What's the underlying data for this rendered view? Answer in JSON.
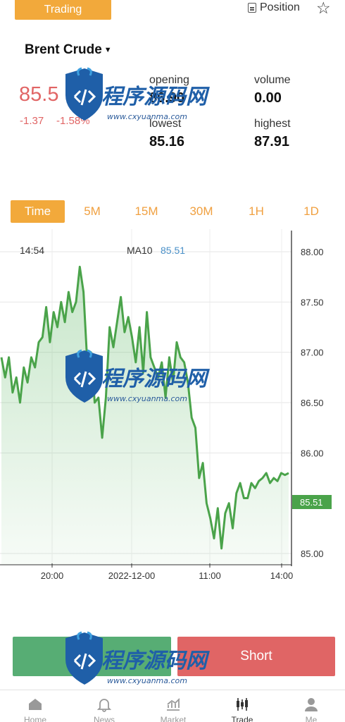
{
  "header": {
    "active_tab": "Trading",
    "position_label": "Position",
    "favorite_icon": "star-icon"
  },
  "instrument": {
    "name": "Brent Crude",
    "price": "85.5",
    "change": "-1.37",
    "change_percent": "-1.58%"
  },
  "stats": {
    "opening_label": "opening",
    "opening_value": "86.90",
    "volume_label": "volume",
    "volume_value": "0.00",
    "lowest_label": "lowest",
    "lowest_value": "85.16",
    "highest_label": "highest",
    "highest_value": "87.91"
  },
  "timeframes": [
    "Time",
    "5M",
    "15M",
    "30M",
    "1H",
    "1D"
  ],
  "timeframe_active": "Time",
  "chart": {
    "cursor_time": "14:54",
    "ma_label": "MA10",
    "ma_value": "85.51",
    "current_price_tag": "85.51"
  },
  "chart_data": {
    "type": "area",
    "title": "",
    "xlabel": "",
    "ylabel": "",
    "x_ticks": [
      "20:00",
      "2022-12-00",
      "11:00",
      "14:00"
    ],
    "y_ticks": [
      "88.00",
      "87.50",
      "87.00",
      "86.50",
      "86.00",
      "85.51",
      "85.00"
    ],
    "ylim": [
      84.9,
      88.1
    ],
    "grid": true,
    "series": [
      {
        "values": [
          86.95,
          86.75,
          86.95,
          86.6,
          86.75,
          86.5,
          86.85,
          86.7,
          86.95,
          86.85,
          87.1,
          87.15,
          87.45,
          87.1,
          87.4,
          87.25,
          87.5,
          87.3,
          87.6,
          87.4,
          87.5,
          87.85,
          87.6,
          86.9,
          87.0,
          86.5,
          86.55,
          86.15,
          86.55,
          87.25,
          87.05,
          87.3,
          87.55,
          87.2,
          87.35,
          87.15,
          86.9,
          87.25,
          86.8,
          87.4,
          86.95,
          86.85,
          86.75,
          86.9,
          86.55,
          86.95,
          86.7,
          87.1,
          86.95,
          86.9,
          86.7,
          86.35,
          86.25,
          85.75,
          85.9,
          85.5,
          85.35,
          85.15,
          85.45,
          85.05,
          85.4,
          85.5,
          85.25,
          85.6,
          85.7,
          85.55,
          85.55,
          85.7,
          85.65,
          85.72,
          85.75,
          85.8,
          85.7,
          85.75,
          85.72,
          85.8,
          85.78,
          85.8
        ]
      }
    ]
  },
  "actions": {
    "long_label": "",
    "short_label": "Short"
  },
  "nav": {
    "items": [
      {
        "label": "Home",
        "icon": "home-icon"
      },
      {
        "label": "News",
        "icon": "bell-icon"
      },
      {
        "label": "Market",
        "icon": "chart-icon"
      },
      {
        "label": "Trade",
        "icon": "candlestick-icon"
      },
      {
        "label": "Me",
        "icon": "user-icon"
      }
    ],
    "active": "Trade"
  },
  "watermark": {
    "title": "程序源码网",
    "url": "www.cxyuanma.com"
  }
}
